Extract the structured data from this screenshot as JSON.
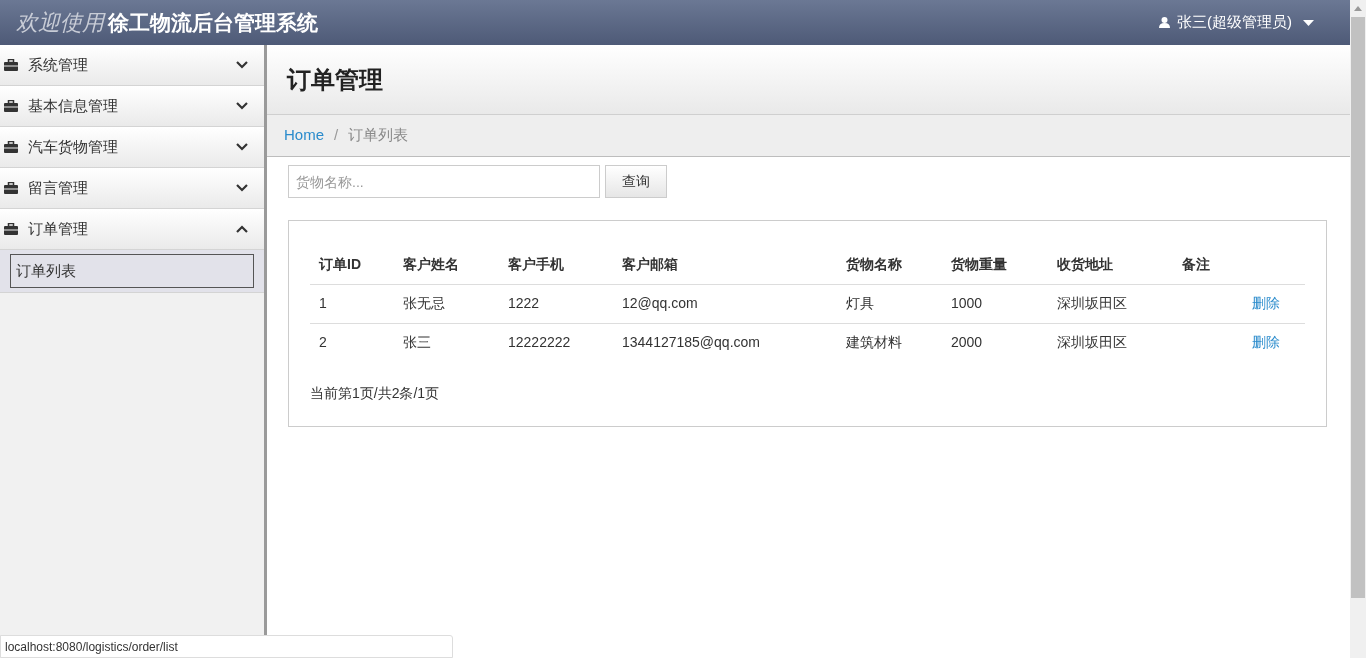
{
  "header": {
    "welcome": "欢迎使用",
    "title": "徐工物流后台管理系统",
    "user": "张三(超级管理员)"
  },
  "sidebar": {
    "items": [
      {
        "label": "系统管理",
        "expanded": false
      },
      {
        "label": "基本信息管理",
        "expanded": false
      },
      {
        "label": "汽车货物管理",
        "expanded": false
      },
      {
        "label": "留言管理",
        "expanded": false
      },
      {
        "label": "订单管理",
        "expanded": true,
        "children": [
          {
            "label": "订单列表",
            "selected": true
          }
        ]
      }
    ]
  },
  "page_title": "订单管理",
  "breadcrumb": {
    "items": [
      "Home",
      "订单列表"
    ],
    "separator": "/"
  },
  "search": {
    "placeholder": "货物名称...",
    "button": "查询"
  },
  "table": {
    "columns": [
      "订单ID",
      "客户姓名",
      "客户手机",
      "客户邮箱",
      "货物名称",
      "货物重量",
      "收货地址",
      "备注"
    ],
    "rows": [
      {
        "cells": [
          "1",
          "张无忌",
          "1222",
          "12@qq.com",
          "灯具",
          "1000",
          "深圳坂田区",
          ""
        ],
        "action": "删除"
      },
      {
        "cells": [
          "2",
          "张三",
          "12222222",
          "1344127185@qq.com",
          "建筑材料",
          "2000",
          "深圳坂田区",
          ""
        ],
        "action": "删除"
      }
    ]
  },
  "pagination": "当前第1页/共2条/1页",
  "status_bar": "localhost:8080/logistics/order/list"
}
